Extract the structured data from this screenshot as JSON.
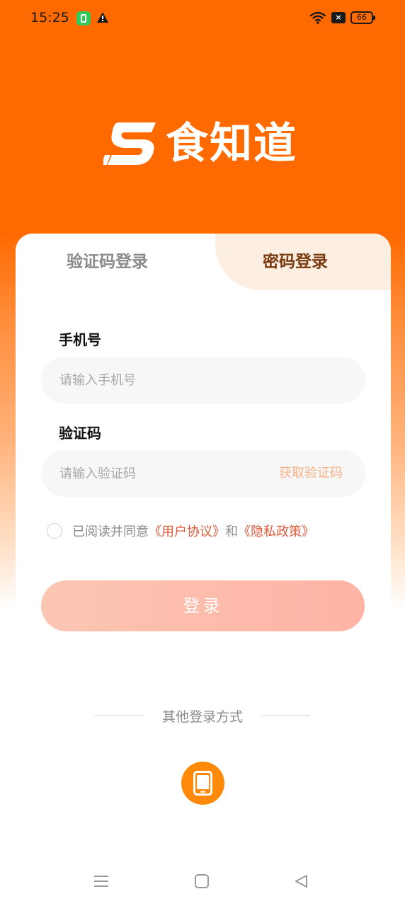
{
  "status_bar": {
    "time": "15:25",
    "battery_level": "66",
    "x_badge": "×",
    "icons": [
      "app-notification-icon",
      "warning-icon",
      "wifi-icon",
      "x-box-icon",
      "battery-icon"
    ]
  },
  "brand": {
    "name": "食知道",
    "color": "#ff6a00"
  },
  "tabs": [
    {
      "label": "验证码登录",
      "active": false
    },
    {
      "label": "密码登录",
      "active": true
    }
  ],
  "form": {
    "phone_label": "手机号",
    "phone_placeholder": "请输入手机号",
    "code_label": "验证码",
    "code_placeholder": "请输入验证码",
    "get_code_label": "获取验证码"
  },
  "agreement": {
    "prefix": "已阅读并同意",
    "user_agreement": "《用户协议》",
    "and": "和",
    "privacy_policy": "《隐私政策》",
    "checked": false
  },
  "login_button": "登录",
  "other_login": {
    "title": "其他登录方式",
    "methods": [
      "phone-icon"
    ]
  },
  "nav_bar": {
    "icons": [
      "menu-icon",
      "home-square-icon",
      "back-triangle-icon"
    ]
  }
}
